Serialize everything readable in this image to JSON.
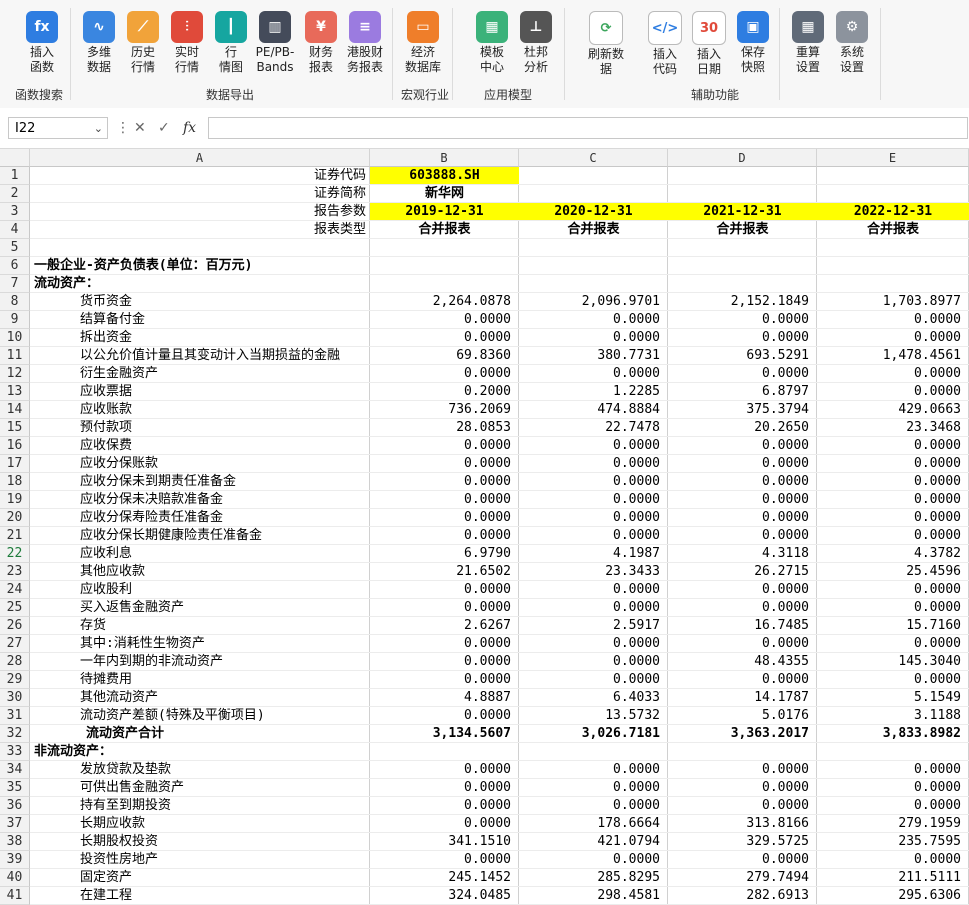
{
  "ribbon": {
    "buttons": [
      {
        "label1": "插入",
        "label2": "函数",
        "icon": "fx-icon",
        "color": "#2e7de1",
        "glyph": "fx"
      },
      {
        "label1": "多维",
        "label2": "数据",
        "icon": "line-chart-icon",
        "color": "#3a86e0",
        "glyph": "∿"
      },
      {
        "label1": "历史",
        "label2": "行情",
        "icon": "history-chart-icon",
        "color": "#f1a33a",
        "glyph": "⟋"
      },
      {
        "label1": "实时",
        "label2": "行情",
        "icon": "realtime-chart-icon",
        "color": "#e04a3a",
        "glyph": "⫶"
      },
      {
        "label1": "行",
        "label2": "情图",
        "icon": "candlestick-icon",
        "color": "#16a6a0",
        "glyph": "┃"
      },
      {
        "label1": "PE/PB-",
        "label2": "Bands",
        "icon": "bar-chart-icon",
        "color": "#444b5a",
        "glyph": "▥"
      },
      {
        "label1": "财务",
        "label2": "报表",
        "icon": "finance-report-icon",
        "color": "#e86a5a",
        "glyph": "¥"
      },
      {
        "label1": "港股财",
        "label2": "务报表",
        "icon": "hk-report-icon",
        "color": "#9b7be0",
        "glyph": "≡"
      },
      {
        "label1": "经济",
        "label2": "数据库",
        "icon": "database-icon",
        "color": "#ef7e2a",
        "glyph": "▭"
      },
      {
        "label1": "模板",
        "label2": "中心",
        "icon": "template-icon",
        "color": "#3bb27a",
        "glyph": "▦"
      },
      {
        "label1": "杜邦",
        "label2": "分析",
        "icon": "dupont-tree-icon",
        "color": "#555",
        "glyph": "⊥"
      },
      {
        "label1": "刷新数",
        "label2": "据",
        "icon": "refresh-icon",
        "color": "#ffffff",
        "glyph": "⟳"
      },
      {
        "label1": "插入",
        "label2": "代码",
        "icon": "code-icon",
        "color": "#ffffff",
        "glyph": "</>"
      },
      {
        "label1": "插入",
        "label2": "日期",
        "icon": "calendar-icon",
        "color": "#ffffff",
        "glyph": "30"
      },
      {
        "label1": "保存",
        "label2": "快照",
        "icon": "save-icon",
        "color": "#2e7de1",
        "glyph": "▣"
      },
      {
        "label1": "重算",
        "label2": "设置",
        "icon": "calculator-icon",
        "color": "#606a78",
        "glyph": "▦"
      },
      {
        "label1": "系统",
        "label2": "设置",
        "icon": "gear-icon",
        "color": "#8c939d",
        "glyph": "⚙"
      }
    ],
    "groups": [
      "函数搜索",
      "数据导出",
      "宏观行业",
      "应用模型",
      "辅助功能"
    ]
  },
  "formula_bar": {
    "name_box": "I22",
    "fx_label": "fx",
    "value": ""
  },
  "columns": [
    "A",
    "B",
    "C",
    "D",
    "E"
  ],
  "rows": [
    {
      "n": "1",
      "a": "证券代码",
      "b": "603888.SH",
      "c": "",
      "d": "",
      "e": ""
    },
    {
      "n": "2",
      "a": "证券简称",
      "b": "新华网",
      "c": "",
      "d": "",
      "e": ""
    },
    {
      "n": "3",
      "a": "报告参数",
      "b": "2019-12-31",
      "c": "2020-12-31",
      "d": "2021-12-31",
      "e": "2022-12-31"
    },
    {
      "n": "4",
      "a": "报表类型",
      "b": "合并报表",
      "c": "合并报表",
      "d": "合并报表",
      "e": "合并报表"
    },
    {
      "n": "5",
      "a": "",
      "b": "",
      "c": "",
      "d": "",
      "e": ""
    },
    {
      "n": "6",
      "a": "一般企业-资产负债表(单位：百万元)",
      "b": "",
      "c": "",
      "d": "",
      "e": ""
    },
    {
      "n": "7",
      "a": "流动资产：",
      "b": "",
      "c": "",
      "d": "",
      "e": ""
    },
    {
      "n": "8",
      "a": "货币资金",
      "b": "2,264.0878",
      "c": "2,096.9701",
      "d": "2,152.1849",
      "e": "1,703.8977"
    },
    {
      "n": "9",
      "a": "结算备付金",
      "b": "0.0000",
      "c": "0.0000",
      "d": "0.0000",
      "e": "0.0000"
    },
    {
      "n": "10",
      "a": "拆出资金",
      "b": "0.0000",
      "c": "0.0000",
      "d": "0.0000",
      "e": "0.0000"
    },
    {
      "n": "11",
      "a": "以公允价值计量且其变动计入当期损益的金融",
      "b": "69.8360",
      "c": "380.7731",
      "d": "693.5291",
      "e": "1,478.4561"
    },
    {
      "n": "12",
      "a": "衍生金融资产",
      "b": "0.0000",
      "c": "0.0000",
      "d": "0.0000",
      "e": "0.0000"
    },
    {
      "n": "13",
      "a": "应收票据",
      "b": "0.2000",
      "c": "1.2285",
      "d": "6.8797",
      "e": "0.0000"
    },
    {
      "n": "14",
      "a": "应收账款",
      "b": "736.2069",
      "c": "474.8884",
      "d": "375.3794",
      "e": "429.0663"
    },
    {
      "n": "15",
      "a": "预付款项",
      "b": "28.0853",
      "c": "22.7478",
      "d": "20.2650",
      "e": "23.3468"
    },
    {
      "n": "16",
      "a": "应收保费",
      "b": "0.0000",
      "c": "0.0000",
      "d": "0.0000",
      "e": "0.0000"
    },
    {
      "n": "17",
      "a": "应收分保账款",
      "b": "0.0000",
      "c": "0.0000",
      "d": "0.0000",
      "e": "0.0000"
    },
    {
      "n": "18",
      "a": "应收分保未到期责任准备金",
      "b": "0.0000",
      "c": "0.0000",
      "d": "0.0000",
      "e": "0.0000"
    },
    {
      "n": "19",
      "a": "应收分保未决赔款准备金",
      "b": "0.0000",
      "c": "0.0000",
      "d": "0.0000",
      "e": "0.0000"
    },
    {
      "n": "20",
      "a": "应收分保寿险责任准备金",
      "b": "0.0000",
      "c": "0.0000",
      "d": "0.0000",
      "e": "0.0000"
    },
    {
      "n": "21",
      "a": "应收分保长期健康险责任准备金",
      "b": "0.0000",
      "c": "0.0000",
      "d": "0.0000",
      "e": "0.0000"
    },
    {
      "n": "22",
      "a": "应收利息",
      "b": "6.9790",
      "c": "4.1987",
      "d": "4.3118",
      "e": "4.3782"
    },
    {
      "n": "23",
      "a": "其他应收款",
      "b": "21.6502",
      "c": "23.3433",
      "d": "26.2715",
      "e": "25.4596"
    },
    {
      "n": "24",
      "a": "应收股利",
      "b": "0.0000",
      "c": "0.0000",
      "d": "0.0000",
      "e": "0.0000"
    },
    {
      "n": "25",
      "a": "买入返售金融资产",
      "b": "0.0000",
      "c": "0.0000",
      "d": "0.0000",
      "e": "0.0000"
    },
    {
      "n": "26",
      "a": "存货",
      "b": "2.6267",
      "c": "2.5917",
      "d": "16.7485",
      "e": "15.7160"
    },
    {
      "n": "27",
      "a": "其中:消耗性生物资产",
      "b": "0.0000",
      "c": "0.0000",
      "d": "0.0000",
      "e": "0.0000"
    },
    {
      "n": "28",
      "a": "一年内到期的非流动资产",
      "b": "0.0000",
      "c": "0.0000",
      "d": "48.4355",
      "e": "145.3040"
    },
    {
      "n": "29",
      "a": "待摊费用",
      "b": "0.0000",
      "c": "0.0000",
      "d": "0.0000",
      "e": "0.0000"
    },
    {
      "n": "30",
      "a": "其他流动资产",
      "b": "4.8887",
      "c": "6.4033",
      "d": "14.1787",
      "e": "5.1549"
    },
    {
      "n": "31",
      "a": "流动资产差额(特殊及平衡项目)",
      "b": "0.0000",
      "c": "13.5732",
      "d": "5.0176",
      "e": "3.1188"
    },
    {
      "n": "32",
      "a": "流动资产合计",
      "b": "3,134.5607",
      "c": "3,026.7181",
      "d": "3,363.2017",
      "e": "3,833.8982"
    },
    {
      "n": "33",
      "a": "非流动资产：",
      "b": "",
      "c": "",
      "d": "",
      "e": ""
    },
    {
      "n": "34",
      "a": "发放贷款及垫款",
      "b": "0.0000",
      "c": "0.0000",
      "d": "0.0000",
      "e": "0.0000"
    },
    {
      "n": "35",
      "a": "可供出售金融资产",
      "b": "0.0000",
      "c": "0.0000",
      "d": "0.0000",
      "e": "0.0000"
    },
    {
      "n": "36",
      "a": "持有至到期投资",
      "b": "0.0000",
      "c": "0.0000",
      "d": "0.0000",
      "e": "0.0000"
    },
    {
      "n": "37",
      "a": "长期应收款",
      "b": "0.0000",
      "c": "178.6664",
      "d": "313.8166",
      "e": "279.1959"
    },
    {
      "n": "38",
      "a": "长期股权投资",
      "b": "341.1510",
      "c": "421.0794",
      "d": "329.5725",
      "e": "235.7595"
    },
    {
      "n": "39",
      "a": "投资性房地产",
      "b": "0.0000",
      "c": "0.0000",
      "d": "0.0000",
      "e": "0.0000"
    },
    {
      "n": "40",
      "a": "固定资产",
      "b": "245.1452",
      "c": "285.8295",
      "d": "279.7494",
      "e": "211.5111"
    },
    {
      "n": "41",
      "a": "在建工程",
      "b": "324.0485",
      "c": "298.4581",
      "d": "282.6913",
      "e": "295.6306"
    }
  ]
}
